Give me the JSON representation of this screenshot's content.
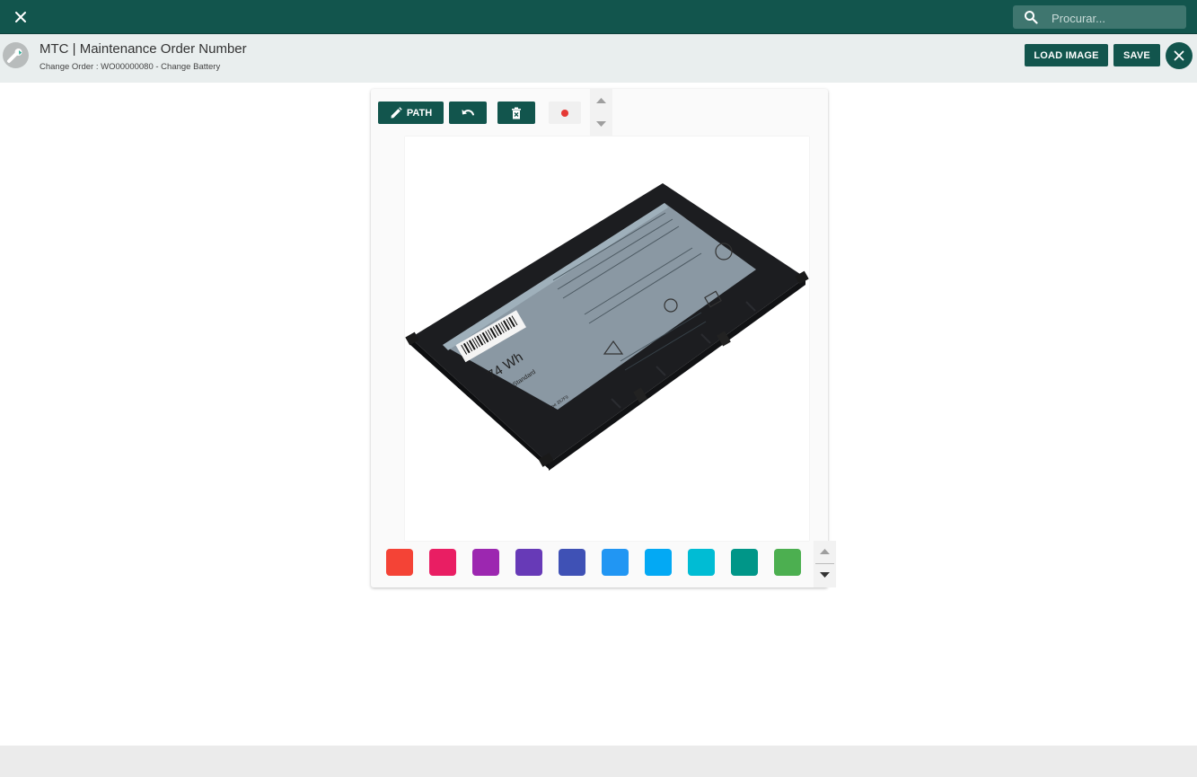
{
  "topbar": {
    "search_placeholder": "Procurar...",
    "close_icon": "close-icon",
    "search_icon": "search-icon"
  },
  "header": {
    "title": "MTC | Maintenance Order Number",
    "subtitle": "Change Order : WO00000080 - Change Battery",
    "load_image_label": "LOAD IMAGE",
    "save_label": "SAVE"
  },
  "editor": {
    "path_label": "PATH",
    "selected_color": "#e53935",
    "battery_label": {
      "capacity": "74 Wh",
      "type": "Standard",
      "model": "Type 357F9"
    },
    "palette": [
      "#f44336",
      "#e91e63",
      "#9c27b0",
      "#673ab7",
      "#3f51b5",
      "#2196f3",
      "#03a9f4",
      "#00bcd4",
      "#009688",
      "#4caf50"
    ]
  },
  "colors": {
    "brand": "#12554d",
    "header_bg": "#e9eeee"
  }
}
